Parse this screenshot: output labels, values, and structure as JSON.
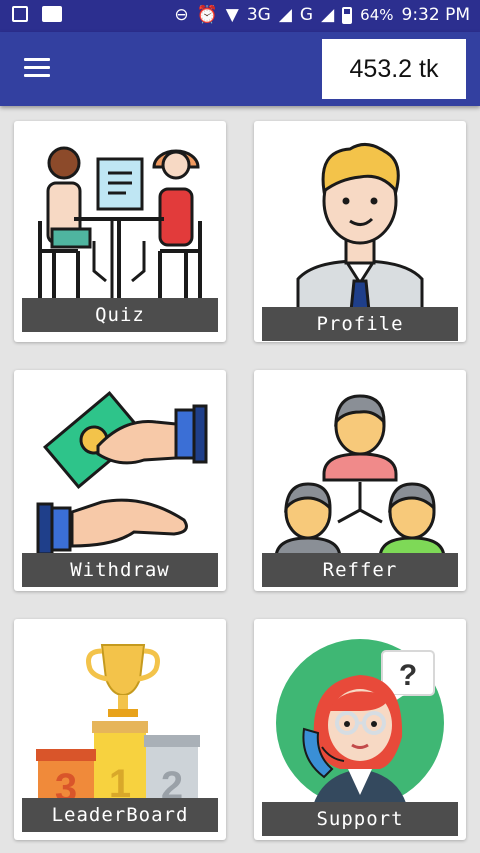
{
  "status_bar": {
    "network_label": "3G",
    "network2_label": "G",
    "battery": "64%",
    "time": "9:32 PM",
    "icons": [
      "gallery-icon",
      "chat-icon",
      "dnd-icon",
      "alarm-icon",
      "wifi-icon",
      "signal-icon",
      "battery-icon"
    ]
  },
  "app_bar": {
    "menu_icon": "hamburger-menu-icon",
    "balance": "453.2 tk"
  },
  "menu": {
    "items": [
      {
        "label": "Quiz",
        "icon": "quiz-icon"
      },
      {
        "label": "Profile",
        "icon": "profile-icon"
      },
      {
        "label": "Withdraw",
        "icon": "withdraw-icon"
      },
      {
        "label": "Reffer",
        "icon": "reffer-icon"
      },
      {
        "label": "LeaderBoard",
        "icon": "leaderboard-icon"
      },
      {
        "label": "Support",
        "icon": "support-icon"
      }
    ]
  },
  "colors": {
    "status_bar": "#2c2f8f",
    "app_bar": "#3340a0",
    "background": "#e4e4e4",
    "label_bar": "#4d4d4d"
  }
}
